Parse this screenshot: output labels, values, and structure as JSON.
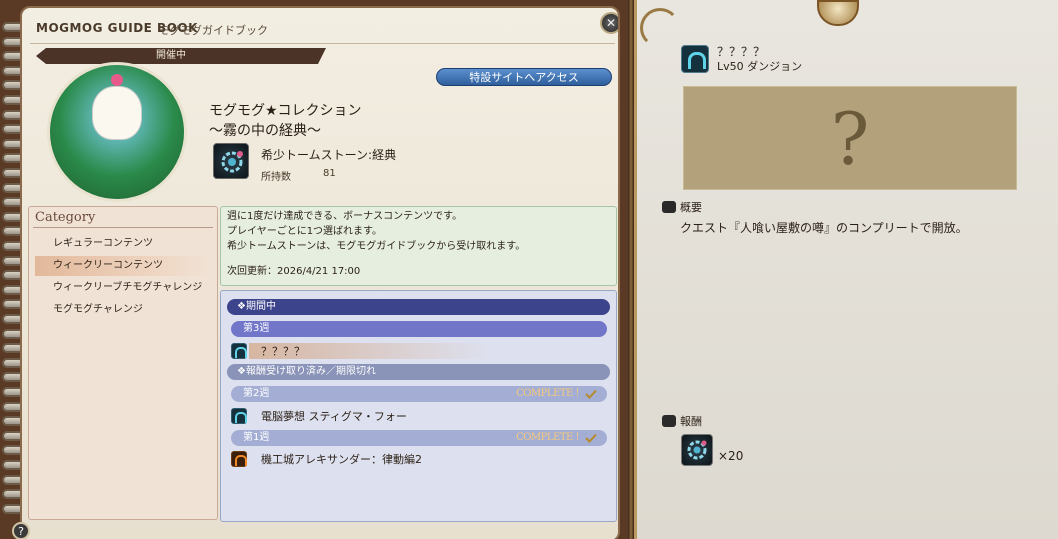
{
  "header": {
    "title": "MOGMOG GUIDE BOOK",
    "subtitle": "モグモグガイドブック",
    "close_icon": "close-icon"
  },
  "status": "開催中",
  "site_button": "特設サイトへアクセス",
  "event": {
    "title_line1": "モグモグ★コレクション",
    "title_line2": "～霧の中の経典～",
    "tome_name": "希少トームストーン:経典",
    "held_label": "所持数",
    "held_value": "81"
  },
  "category": {
    "heading": "Category",
    "items": [
      {
        "label": "レギュラーコンテンツ",
        "selected": false
      },
      {
        "label": "ウィークリーコンテンツ",
        "selected": true
      },
      {
        "label": "ウィークリーブチモグチャレンジ",
        "selected": false
      },
      {
        "label": "モグモグチャレンジ",
        "selected": false
      }
    ]
  },
  "info": {
    "line1": "週に1度だけ達成できる、ボーナスコンテンツです。",
    "line2": "プレイヤーごとに1つ選ばれます。",
    "line3": "希少トームストーンは、モグモグガイドブックから受け取れます。",
    "update": "次回更新：2026/4/21 17:00"
  },
  "list": {
    "active_header": "❖期間中",
    "active_week": "第3週",
    "active_item": "？？？？",
    "done_header": "❖報酬受け取り済み／期限切れ",
    "week2": "第2週",
    "week2_status": "COMPLETE !",
    "week2_item": "電脳夢想 スティグマ・フォー",
    "week1": "第1週",
    "week1_status": "COMPLETE !",
    "week1_item": "機工城アレキサンダー：律動編2"
  },
  "help": "?",
  "detail": {
    "name": "？？？？",
    "level": "Lv50 ダンジョン",
    "image_placeholder": "?",
    "summary_label": "概要",
    "summary_text": "クエスト『人喰い屋敷の噂』のコンプリートで開放。",
    "reward_label": "報酬",
    "reward_count": "×20"
  }
}
